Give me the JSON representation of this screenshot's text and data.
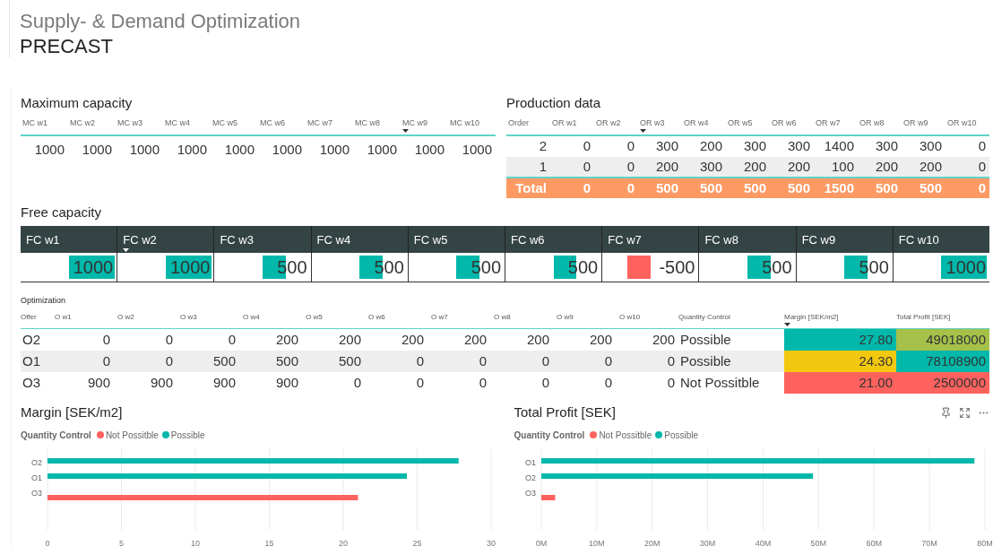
{
  "header": {
    "title": "Supply- & Demand Optimization",
    "subtitle": "PRECAST"
  },
  "max_capacity": {
    "title": "Maximum capacity",
    "columns": [
      {
        "label": "MC w1",
        "sorted": false
      },
      {
        "label": "MC w2",
        "sorted": false
      },
      {
        "label": "MC w3",
        "sorted": false
      },
      {
        "label": "MC w4",
        "sorted": false
      },
      {
        "label": "MC w5",
        "sorted": false
      },
      {
        "label": "MC w6",
        "sorted": false
      },
      {
        "label": "MC w7",
        "sorted": false
      },
      {
        "label": "MC w8",
        "sorted": false
      },
      {
        "label": "MC w9",
        "sorted": true
      },
      {
        "label": "MC w10",
        "sorted": false
      }
    ],
    "rows": [
      [
        "1000",
        "1000",
        "1000",
        "1000",
        "1000",
        "1000",
        "1000",
        "1000",
        "1000",
        "1000"
      ]
    ]
  },
  "production_data": {
    "title": "Production data",
    "columns": [
      {
        "label": "Order",
        "sorted": false
      },
      {
        "label": "OR w1",
        "sorted": false
      },
      {
        "label": "OR w2",
        "sorted": false
      },
      {
        "label": "OR w3",
        "sorted": true
      },
      {
        "label": "OR w4",
        "sorted": false
      },
      {
        "label": "OR w5",
        "sorted": false
      },
      {
        "label": "OR w6",
        "sorted": false
      },
      {
        "label": "OR w7",
        "sorted": false
      },
      {
        "label": "OR w8",
        "sorted": false
      },
      {
        "label": "OR w9",
        "sorted": false
      },
      {
        "label": "OR w10",
        "sorted": false
      }
    ],
    "rows": [
      [
        "2",
        "0",
        "0",
        "300",
        "200",
        "300",
        "300",
        "1400",
        "300",
        "300",
        "0"
      ],
      [
        "1",
        "0",
        "0",
        "200",
        "300",
        "200",
        "200",
        "100",
        "200",
        "200",
        "0"
      ]
    ],
    "total": [
      "Total",
      "0",
      "0",
      "500",
      "500",
      "500",
      "500",
      "1500",
      "500",
      "500",
      "0"
    ]
  },
  "free_capacity": {
    "title": "Free capacity",
    "columns": [
      {
        "label": "FC w1",
        "sorted": false
      },
      {
        "label": "FC w2",
        "sorted": true
      },
      {
        "label": "FC w3",
        "sorted": false
      },
      {
        "label": "FC w4",
        "sorted": false
      },
      {
        "label": "FC w5",
        "sorted": false
      },
      {
        "label": "FC w6",
        "sorted": false
      },
      {
        "label": "FC w7",
        "sorted": false
      },
      {
        "label": "FC w8",
        "sorted": false
      },
      {
        "label": "FC w9",
        "sorted": false
      },
      {
        "label": "FC w10",
        "sorted": false
      }
    ],
    "cells": [
      {
        "value": "1000",
        "kind": "positive",
        "color": "#01b8aa"
      },
      {
        "value": "1000",
        "kind": "positive",
        "color": "#01b8aa"
      },
      {
        "value": "500",
        "kind": "positive",
        "color": "#01b8aa"
      },
      {
        "value": "500",
        "kind": "positive",
        "color": "#01b8aa"
      },
      {
        "value": "500",
        "kind": "positive",
        "color": "#01b8aa"
      },
      {
        "value": "500",
        "kind": "positive",
        "color": "#01b8aa"
      },
      {
        "value": "-500",
        "kind": "negative",
        "color": "#fd625e"
      },
      {
        "value": "500",
        "kind": "positive",
        "color": "#01b8aa"
      },
      {
        "value": "500",
        "kind": "positive",
        "color": "#01b8aa"
      },
      {
        "value": "1000",
        "kind": "positive",
        "color": "#01b8aa"
      }
    ]
  },
  "optimization": {
    "title": "Optimization",
    "columns": [
      {
        "label": "Offer",
        "sorted": false
      },
      {
        "label": "O w1",
        "sorted": false
      },
      {
        "label": "O w2",
        "sorted": false
      },
      {
        "label": "O w3",
        "sorted": false
      },
      {
        "label": "O w4",
        "sorted": false
      },
      {
        "label": "O w5",
        "sorted": false
      },
      {
        "label": "O w6",
        "sorted": false
      },
      {
        "label": "O w7",
        "sorted": false
      },
      {
        "label": "O w8",
        "sorted": false
      },
      {
        "label": "O w9",
        "sorted": false
      },
      {
        "label": "O w10",
        "sorted": false
      },
      {
        "label": "Quantity Control",
        "sorted": false
      },
      {
        "label": "Margin [SEK/m2]",
        "sorted": true
      },
      {
        "label": "Total Profit [SEK]",
        "sorted": false
      }
    ],
    "rows": [
      {
        "cells": [
          "O2",
          "0",
          "0",
          "0",
          "200",
          "200",
          "200",
          "200",
          "200",
          "200",
          "200",
          "Possible"
        ],
        "margin": {
          "value": "27.80",
          "color": "#01b8aa"
        },
        "profit": {
          "value": "49018000",
          "color": "#a5c14a"
        }
      },
      {
        "cells": [
          "O1",
          "0",
          "0",
          "500",
          "500",
          "500",
          "0",
          "0",
          "0",
          "0",
          "0",
          "Possible"
        ],
        "margin": {
          "value": "24.30",
          "color": "#f2c80f"
        },
        "profit": {
          "value": "78108900",
          "color": "#01b8aa"
        }
      },
      {
        "cells": [
          "O3",
          "900",
          "900",
          "900",
          "900",
          "0",
          "0",
          "0",
          "0",
          "0",
          "0",
          "Not Possitble"
        ],
        "margin": {
          "value": "21.00",
          "color": "#fd625e"
        },
        "profit": {
          "value": "2500000",
          "color": "#fd625e"
        }
      }
    ]
  },
  "margin_chart": {
    "title": "Margin [SEK/m2]",
    "legend_title": "Quantity Control",
    "chart_data": {
      "type": "bar",
      "orientation": "horizontal",
      "grid": true,
      "categories": [
        "O2",
        "O1",
        "O3"
      ],
      "series": [
        {
          "name": "Not Possitble",
          "color": "#fd625e",
          "values": [
            null,
            null,
            21.0
          ]
        },
        {
          "name": "Possible",
          "color": "#01b8aa",
          "values": [
            27.8,
            24.3,
            null
          ]
        }
      ],
      "xlim": [
        0,
        30
      ],
      "xticks": [
        0,
        5,
        10,
        15,
        20,
        25,
        30
      ]
    }
  },
  "profit_chart": {
    "title": "Total Profit [SEK]",
    "legend_title": "Quantity Control",
    "chart_data": {
      "type": "bar",
      "orientation": "horizontal",
      "grid": true,
      "categories": [
        "O1",
        "O2",
        "O3"
      ],
      "series": [
        {
          "name": "Not Possitble",
          "color": "#fd625e",
          "values": [
            null,
            null,
            2500000
          ]
        },
        {
          "name": "Possible",
          "color": "#01b8aa",
          "values": [
            78100000,
            49000000,
            null
          ]
        }
      ],
      "xlim": [
        0,
        80000000
      ],
      "xticks": [
        {
          "value": 0,
          "label": "0M"
        },
        {
          "value": 10000000,
          "label": "10M"
        },
        {
          "value": 20000000,
          "label": "20M"
        },
        {
          "value": 30000000,
          "label": "30M"
        },
        {
          "value": 40000000,
          "label": "40M"
        },
        {
          "value": 50000000,
          "label": "50M"
        },
        {
          "value": 60000000,
          "label": "60M"
        },
        {
          "value": 70000000,
          "label": "70M"
        },
        {
          "value": 80000000,
          "label": "80M"
        }
      ]
    }
  }
}
